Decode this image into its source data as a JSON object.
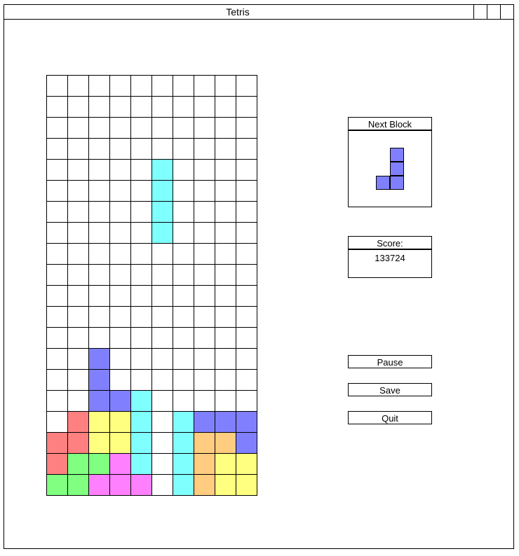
{
  "window": {
    "title": "Tetris"
  },
  "colors": {
    "empty": "#ffffff",
    "cyan": "#80ffff",
    "blue": "#8080ff",
    "yellow": "#ffff80",
    "red": "#ff8080",
    "green": "#80ff80",
    "magenta": "#ff80ff",
    "orange": "#ffcc80"
  },
  "board": {
    "columns": 10,
    "rows": 20,
    "grid": [
      "..........",
      "..........",
      "..........",
      "..........",
      ".....C....",
      ".....C....",
      ".....C....",
      ".....C....",
      "..........",
      "..........",
      "..........",
      "..........",
      "..........",
      "..B.......",
      "..B.......",
      "..BBC.....",
      ".RYYC.CBBB",
      "RRYYC.COOB",
      "RGGMC.COYY",
      "GGMMM.COYY"
    ]
  },
  "next_block": {
    "label": "Next Block",
    "color": "blue",
    "shape": [
      ".B",
      ".B",
      "BB"
    ]
  },
  "score": {
    "label": "Score:",
    "value": "133724"
  },
  "buttons": {
    "pause": "Pause",
    "save": "Save",
    "quit": "Quit"
  }
}
